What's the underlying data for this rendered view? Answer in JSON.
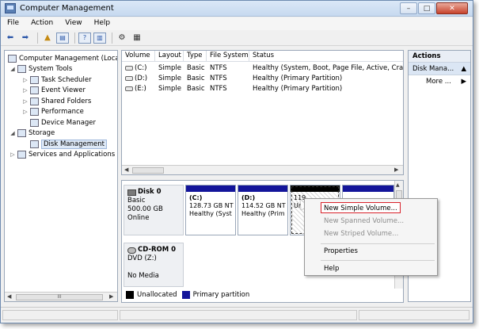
{
  "window": {
    "title": "Computer Management"
  },
  "window_buttons": [
    "–",
    "□",
    "✕"
  ],
  "menu": [
    "File",
    "Action",
    "View",
    "Help"
  ],
  "tree": [
    {
      "label": "Computer Management (Local",
      "exp": "",
      "indent": 0
    },
    {
      "label": "System Tools",
      "exp": "◢",
      "indent": 1
    },
    {
      "label": "Task Scheduler",
      "exp": "▷",
      "indent": 2
    },
    {
      "label": "Event Viewer",
      "exp": "▷",
      "indent": 2
    },
    {
      "label": "Shared Folders",
      "exp": "▷",
      "indent": 2
    },
    {
      "label": "Performance",
      "exp": "▷",
      "indent": 2
    },
    {
      "label": "Device Manager",
      "exp": "",
      "indent": 2
    },
    {
      "label": "Storage",
      "exp": "◢",
      "indent": 1
    },
    {
      "label": "Disk Management",
      "exp": "",
      "indent": 2
    },
    {
      "label": "Services and Applications",
      "exp": "▷",
      "indent": 1
    }
  ],
  "list": {
    "columns": [
      "Volume",
      "Layout",
      "Type",
      "File System",
      "Status"
    ],
    "rows": [
      [
        "(C:)",
        "Simple",
        "Basic",
        "NTFS",
        "Healthy (System, Boot, Page File, Active, Crash D"
      ],
      [
        "(D:)",
        "Simple",
        "Basic",
        "NTFS",
        "Healthy (Primary Partition)"
      ],
      [
        "(E:)",
        "Simple",
        "Basic",
        "NTFS",
        "Healthy (Primary Partition)"
      ]
    ]
  },
  "disk0": {
    "name": "Disk 0",
    "type": "Basic",
    "size": "500.00 GB",
    "state": "Online",
    "partitions": [
      {
        "title": "(C:)",
        "size": "128.73 GB NT",
        "status": "Healthy (Syst"
      },
      {
        "title": "(D:)",
        "size": "114.52 GB NT",
        "status": "Healthy (Prim"
      },
      {
        "title": "",
        "size": "119",
        "status": "Una"
      }
    ]
  },
  "cdrom": {
    "name": "CD-ROM 0",
    "drive": "DVD (Z:)",
    "media": "No Media"
  },
  "legend": {
    "unallocated": "Unallocated",
    "primary": "Primary partition"
  },
  "actions": {
    "header": "Actions",
    "section": "Disk Mana...",
    "more": "More ..."
  },
  "context_menu": {
    "new_simple": "New Simple Volume...",
    "new_spanned": "New Spanned Volume...",
    "new_striped": "New Striped Volume...",
    "properties": "Properties",
    "help": "Help"
  },
  "scroll_glyph": "III",
  "colors": {
    "primary_partition": "#13159a",
    "unallocated": "#000000",
    "highlight_border": "#d8212a"
  }
}
